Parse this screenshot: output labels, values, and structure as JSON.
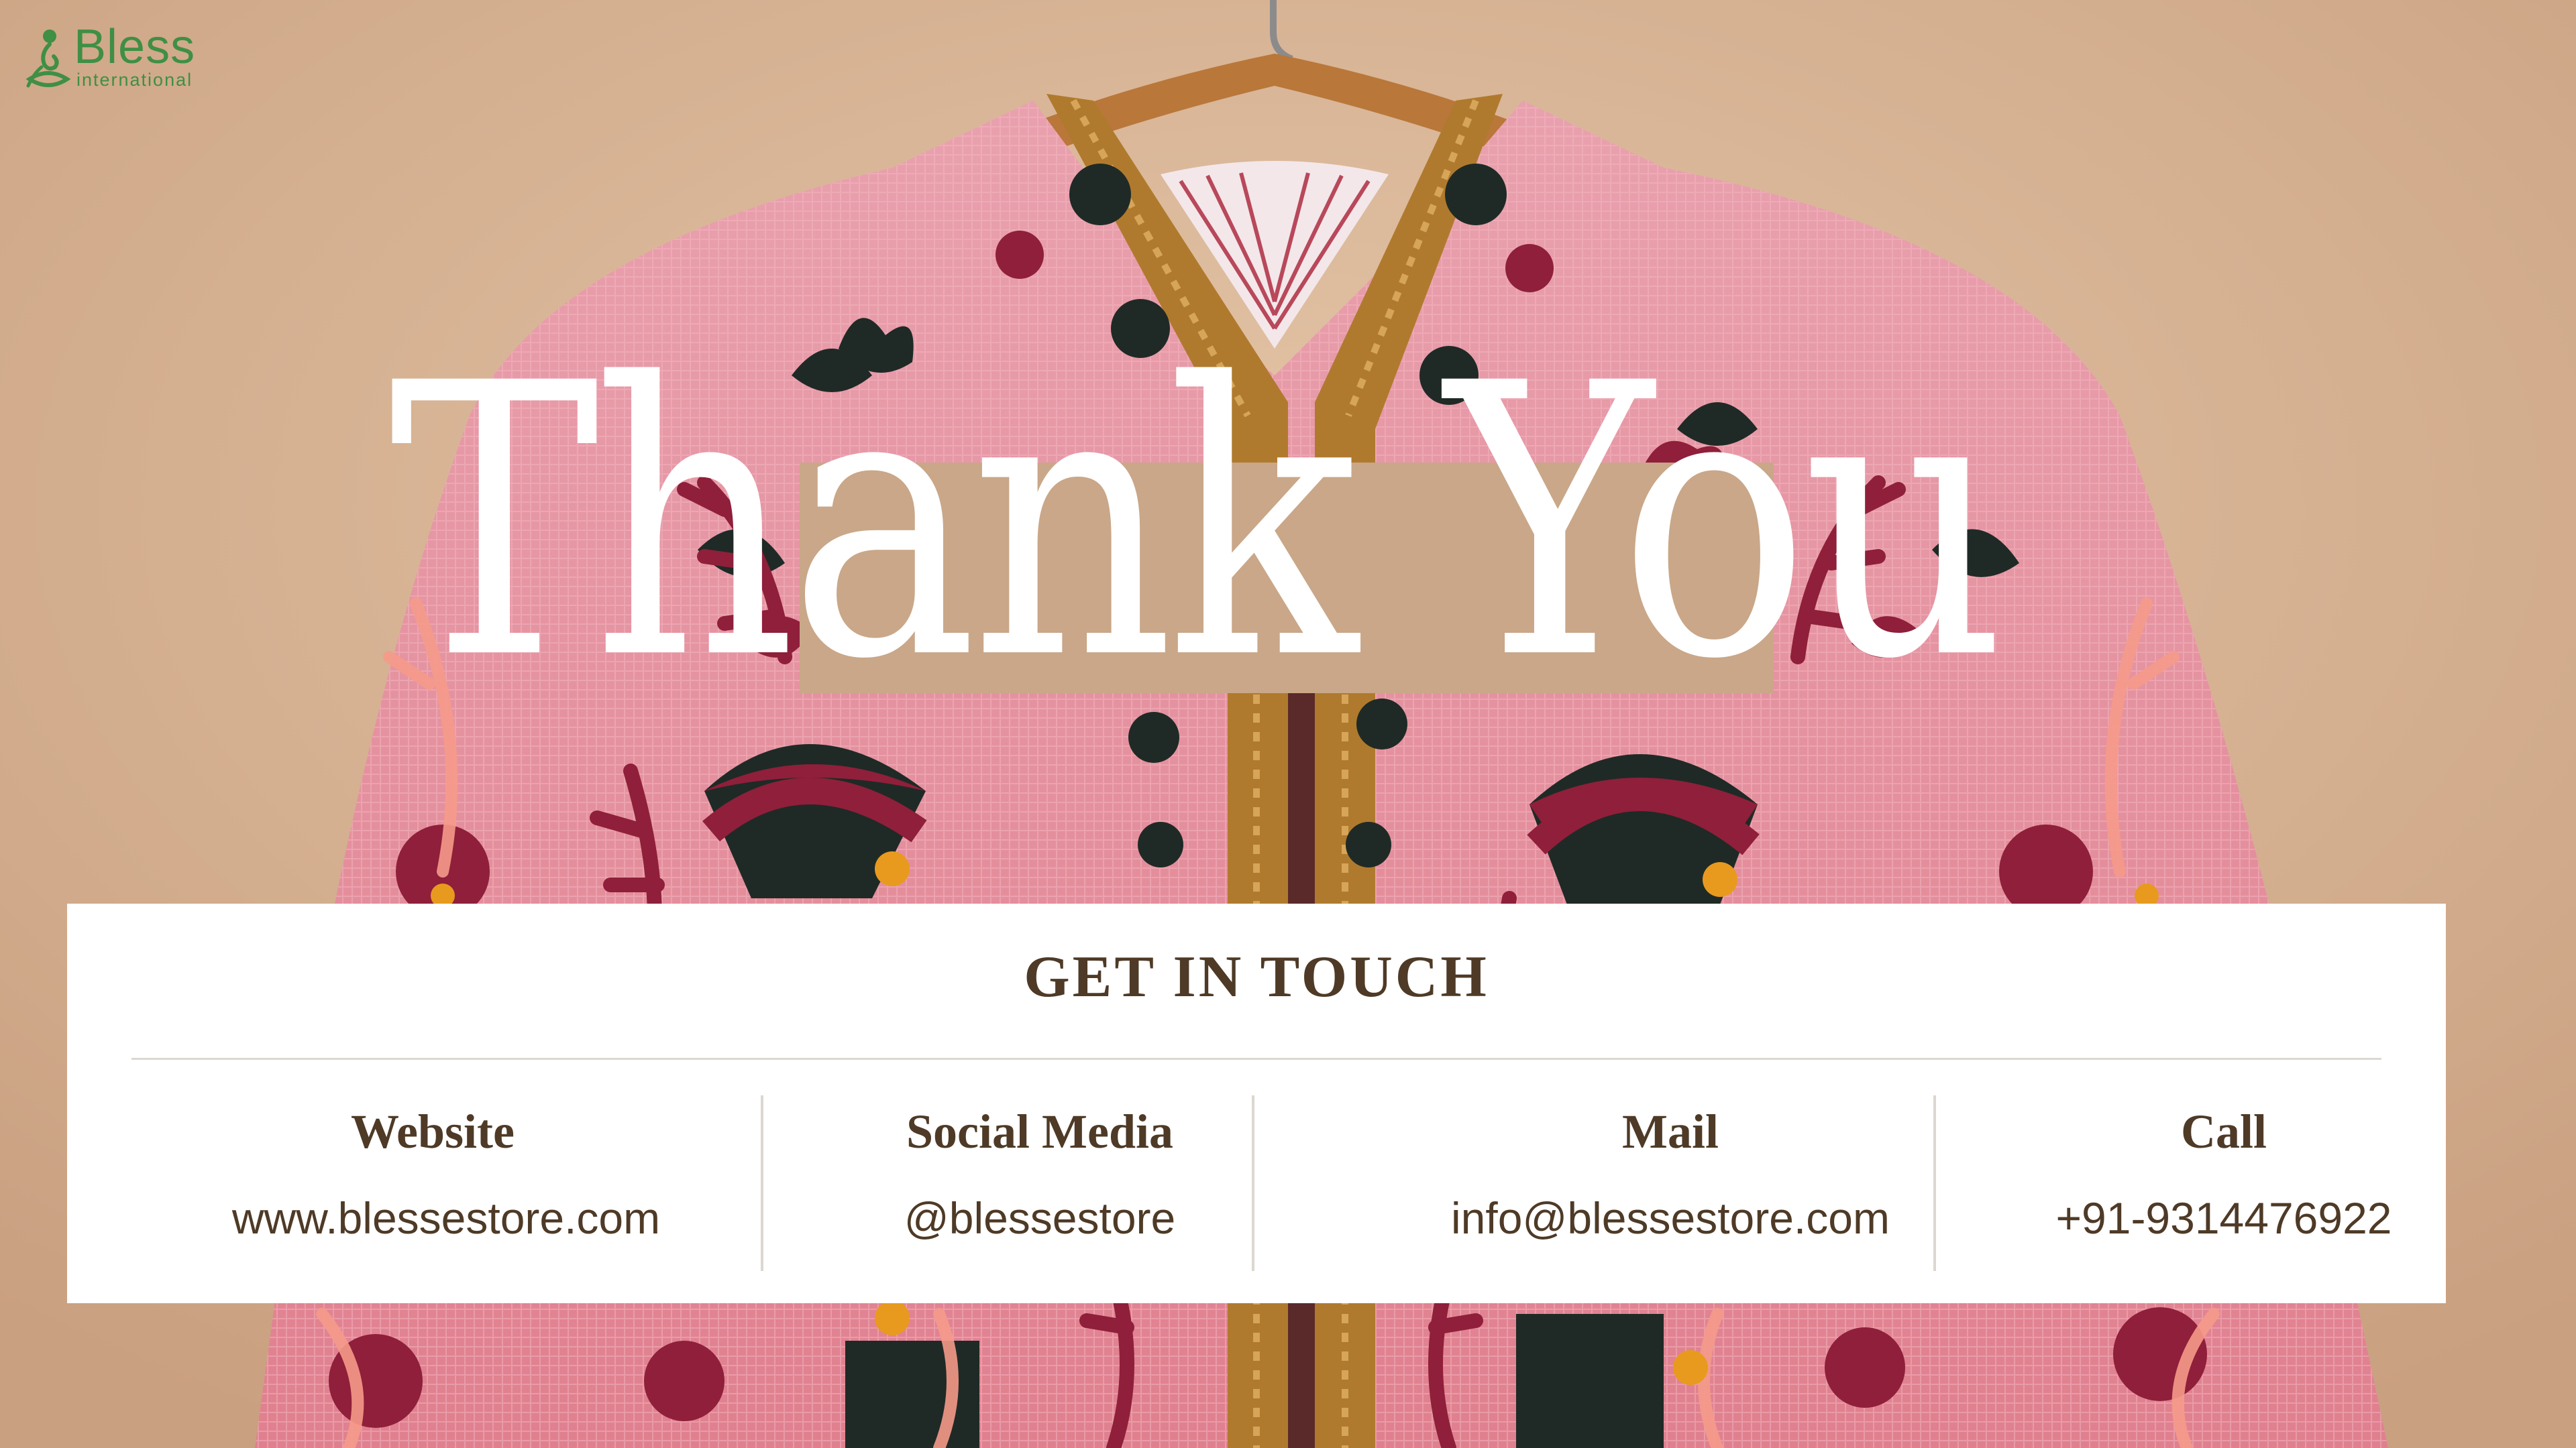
{
  "brand": {
    "name": "Bless",
    "sub": "international",
    "color": "#3f8f45",
    "icon": "yoga-figure-icon"
  },
  "hero": {
    "title": "Thank You",
    "accent_box_color": "#c9a788"
  },
  "contact": {
    "title": "GET IN TOUCH",
    "text_color": "#4e3a26",
    "items": [
      {
        "label": "Website",
        "value": "www.blessestore.com"
      },
      {
        "label": "Social Media",
        "value": "@blessestore"
      },
      {
        "label": "Mail",
        "value": "info@blessestore.com"
      },
      {
        "label": "Call",
        "value": "+91-9314476922"
      }
    ]
  },
  "background": {
    "wall_color": "#d9b89b",
    "jacket_color": "#e48fa0",
    "hanger_color": "#b9773a"
  }
}
